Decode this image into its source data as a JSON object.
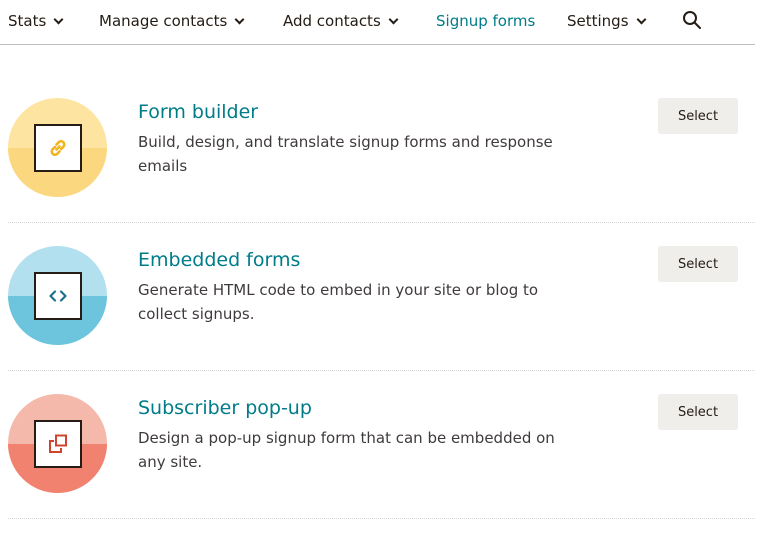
{
  "nav": {
    "items": [
      {
        "label": "Stats",
        "dropdown": true
      },
      {
        "label": "Manage contacts",
        "dropdown": true
      },
      {
        "label": "Add contacts",
        "dropdown": true
      },
      {
        "label": "Signup forms",
        "dropdown": false,
        "active": true
      },
      {
        "label": "Settings",
        "dropdown": true
      }
    ],
    "search_icon": "search-icon"
  },
  "options": [
    {
      "title": "Form builder",
      "description": "Build, design, and translate signup forms and response emails",
      "button_label": "Select",
      "icon": "link-icon",
      "colors": {
        "top": "#fde4a1",
        "bottom": "#fbd780",
        "icon": "#f2b31d"
      }
    },
    {
      "title": "Embedded forms",
      "description": "Generate HTML code to embed in your site or blog to collect signups.",
      "button_label": "Select",
      "icon": "code-brackets-icon",
      "colors": {
        "top": "#b3e0ef",
        "bottom": "#6cc5dd",
        "icon": "#1e6f8c"
      }
    },
    {
      "title": "Subscriber pop-up",
      "description": "Design a pop-up signup form that can be embedded on any site.",
      "button_label": "Select",
      "icon": "popup-window-icon",
      "colors": {
        "top": "#f5b9ac",
        "bottom": "#f0826f",
        "icon": "#d1442c"
      }
    }
  ],
  "accent_color": "#007c89"
}
